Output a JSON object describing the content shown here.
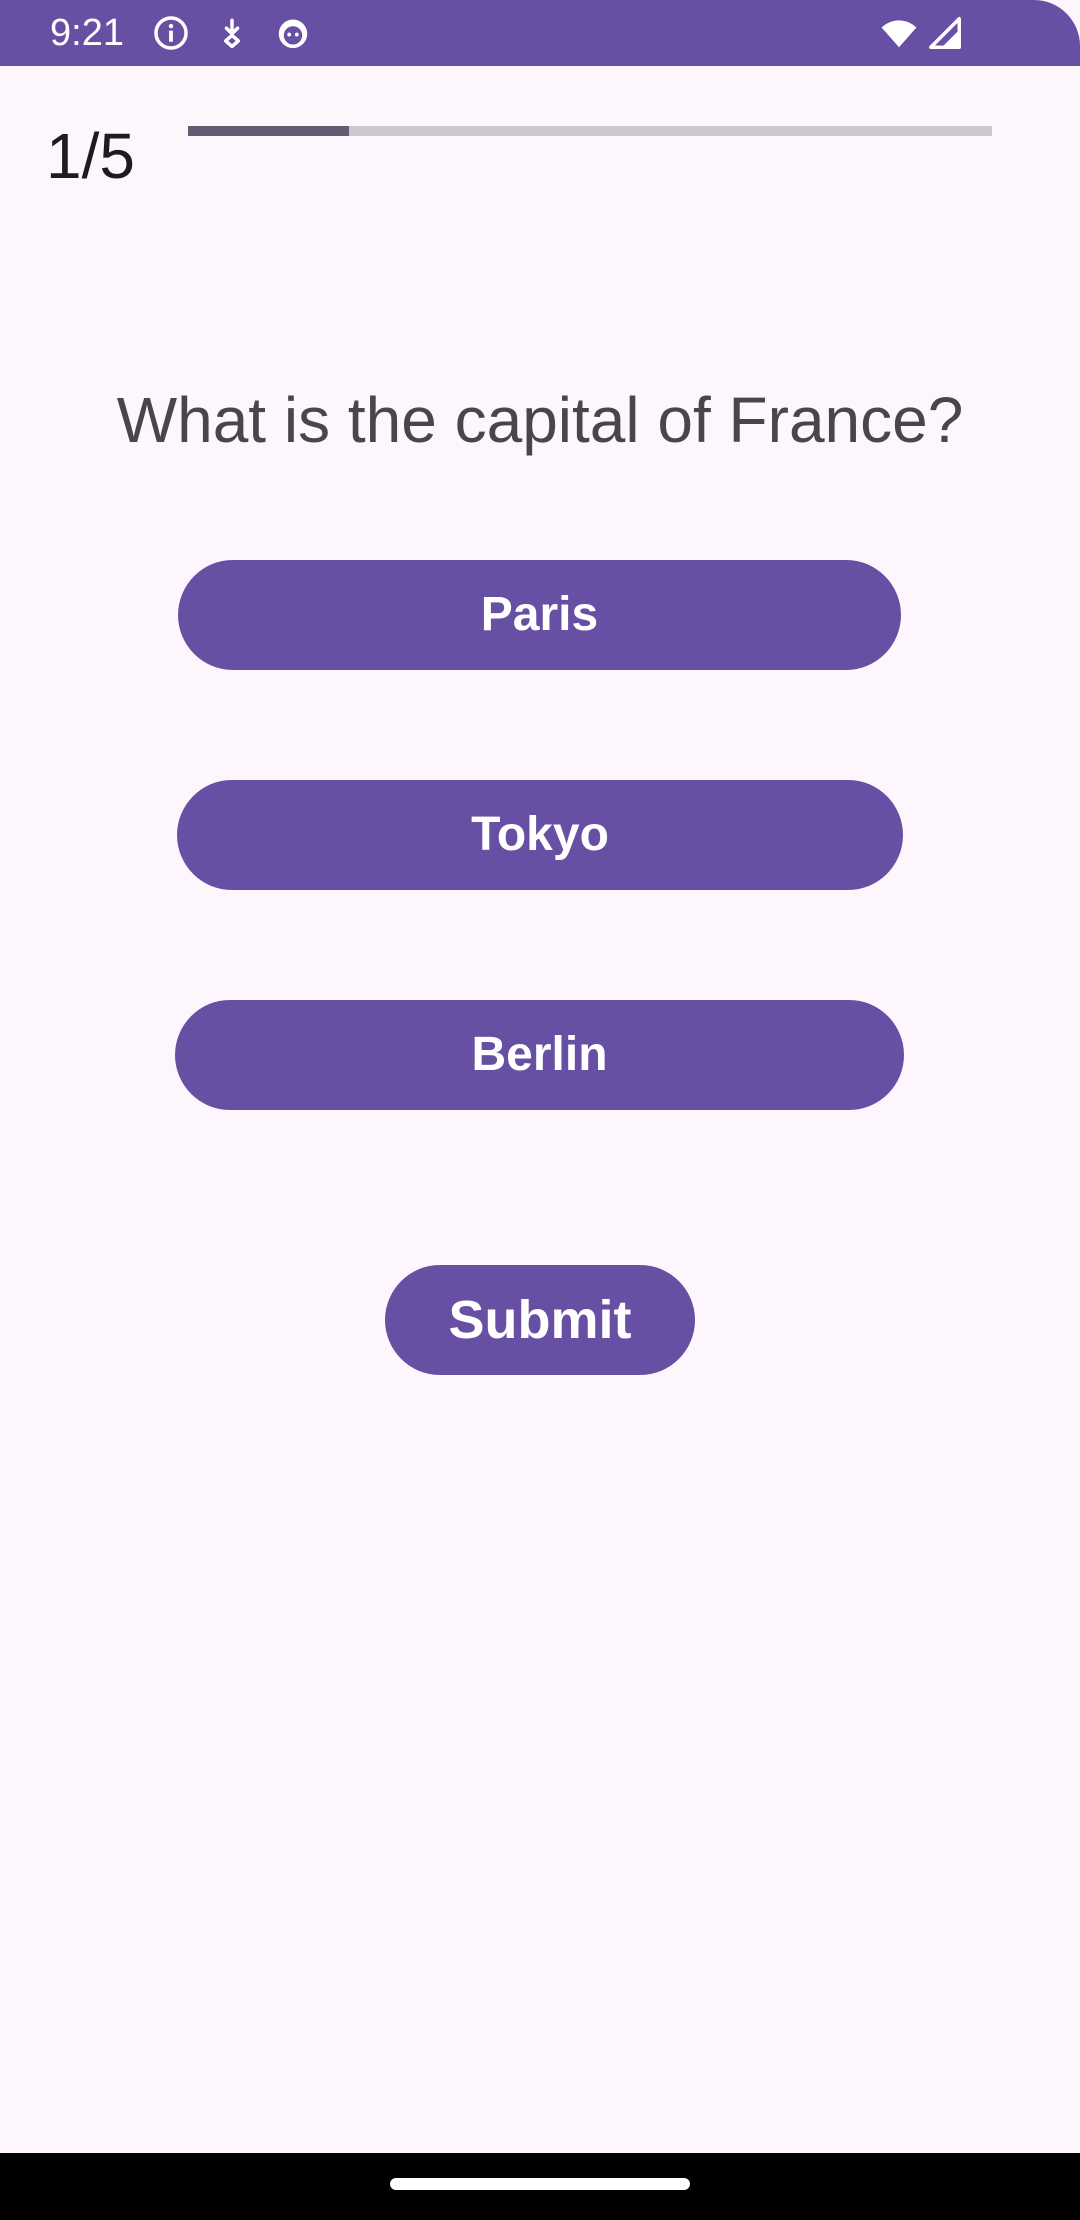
{
  "status_bar": {
    "time": "9:21",
    "icons_left": [
      "info-icon",
      "download-icon",
      "android-robot-icon"
    ],
    "icons_right": [
      "wifi-icon",
      "cellular-signal-icon"
    ],
    "background_color": "#6750a4"
  },
  "progress": {
    "label": "1/5",
    "current": 1,
    "total": 5,
    "fraction": 0.2
  },
  "question": {
    "text": "What is the capital of France?"
  },
  "answers": [
    {
      "label": "Paris"
    },
    {
      "label": "Tokyo"
    },
    {
      "label": "Berlin"
    }
  ],
  "submit": {
    "label": "Submit"
  },
  "colors": {
    "primary": "#6750a4",
    "background": "#fdf7fd",
    "progress_track": "#cdc5d0",
    "progress_fill": "#625b71",
    "question_text": "#49454f"
  }
}
